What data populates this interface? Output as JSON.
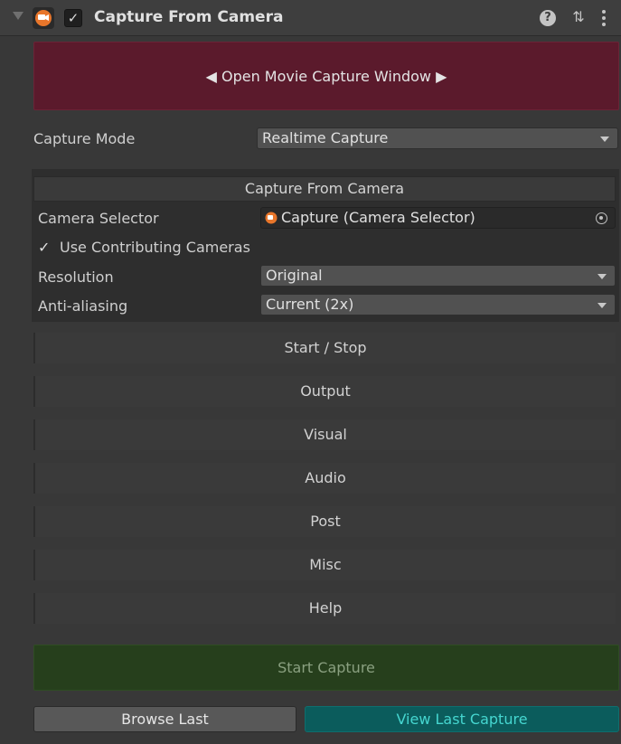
{
  "header": {
    "title": "Capture From Camera",
    "enabled": "✓",
    "help_icon": "?",
    "preset_icon": "⇅"
  },
  "open_window": {
    "label": "◀ Open Movie Capture Window ▶"
  },
  "capture_mode": {
    "label": "Capture Mode",
    "value": "Realtime Capture"
  },
  "section": {
    "title": "Capture From Camera",
    "camera_selector": {
      "label": "Camera Selector",
      "value": "Capture (Camera Selector)"
    },
    "use_contributing": {
      "label": "Use Contributing Cameras",
      "checked": "✓"
    },
    "resolution": {
      "label": "Resolution",
      "value": "Original"
    },
    "anti_aliasing": {
      "label": "Anti-aliasing",
      "value": "Current (2x)"
    }
  },
  "foldouts": [
    "Start / Stop",
    "Output",
    "Visual",
    "Audio",
    "Post",
    "Misc",
    "Help"
  ],
  "actions": {
    "start_capture": "Start Capture",
    "browse_last": "Browse Last",
    "view_last": "View Last Capture"
  },
  "colors": {
    "open_window_bg": "#5b1a2c",
    "start_capture_bg": "#263f1c",
    "view_last_bg": "#0b5c5c",
    "accent_icon": "#e8762b"
  }
}
